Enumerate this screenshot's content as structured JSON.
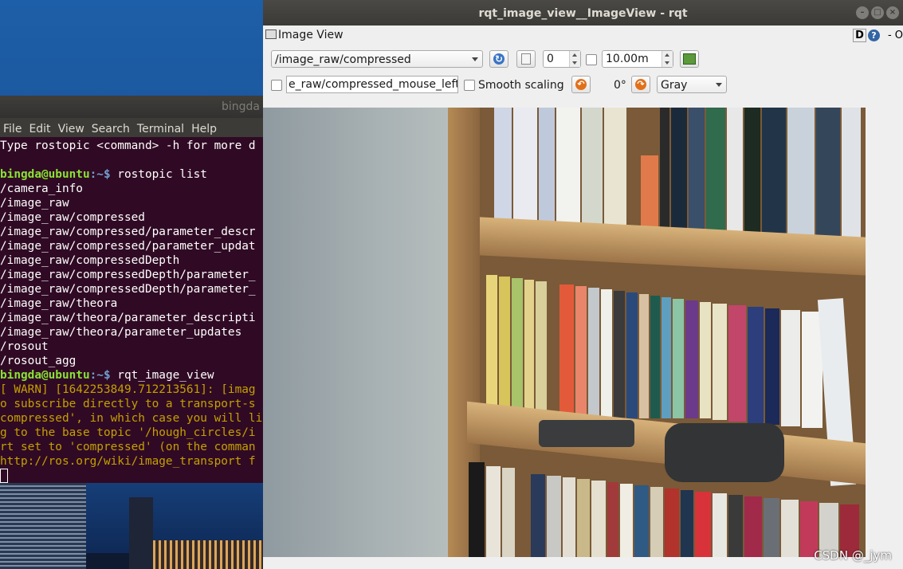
{
  "terminal": {
    "title": "bingda",
    "menu": [
      "File",
      "Edit",
      "View",
      "Search",
      "Terminal",
      "Help"
    ],
    "line0": "Type rostopic <command> -h for more d",
    "prompt1_user": "bingda@ubuntu",
    "prompt1_path": ":~$",
    "prompt1_cmd": " rostopic list",
    "topics": [
      "/camera_info",
      "/image_raw",
      "/image_raw/compressed",
      "/image_raw/compressed/parameter_descr",
      "/image_raw/compressed/parameter_updat",
      "/image_raw/compressedDepth",
      "/image_raw/compressedDepth/parameter_",
      "/image_raw/compressedDepth/parameter_",
      "/image_raw/theora",
      "/image_raw/theora/parameter_descripti",
      "/image_raw/theora/parameter_updates",
      "/rosout",
      "/rosout_agg"
    ],
    "prompt2_user": "bingda@ubuntu",
    "prompt2_path": ":~$",
    "prompt2_cmd": " rqt_image_view",
    "warn_lines": [
      "[ WARN] [1642253849.712213561]: [imag",
      "o subscribe directly to a transport-s",
      "compressed', in which case you will li",
      "g to the base topic '/hough_circles/i",
      "rt set to 'compressed' (on the comman",
      "http://ros.org/wiki/image_transport f"
    ]
  },
  "rqt": {
    "window_title": "rqt_image_view__ImageView - rqt",
    "dock_title": "Image View",
    "dock_d": "D",
    "dock_help": "?",
    "dock_o": "- O",
    "topic_selected": "/image_raw/compressed",
    "spin_value": "0",
    "max_range": "10.00m",
    "mouse_topic": "e_raw/compressed_mouse_left",
    "smooth_scaling_label": "Smooth scaling",
    "rotation_label": "0°",
    "color_scheme": "Gray",
    "smooth_scaling_checked": false,
    "mouse_publish_checked": false,
    "range_checked": false
  },
  "watermark": "CSDN @_jym",
  "colors": {
    "terminal_bg": "#300a24",
    "prompt": "#8ae234",
    "path": "#729fcf",
    "warn": "#c4a000"
  }
}
